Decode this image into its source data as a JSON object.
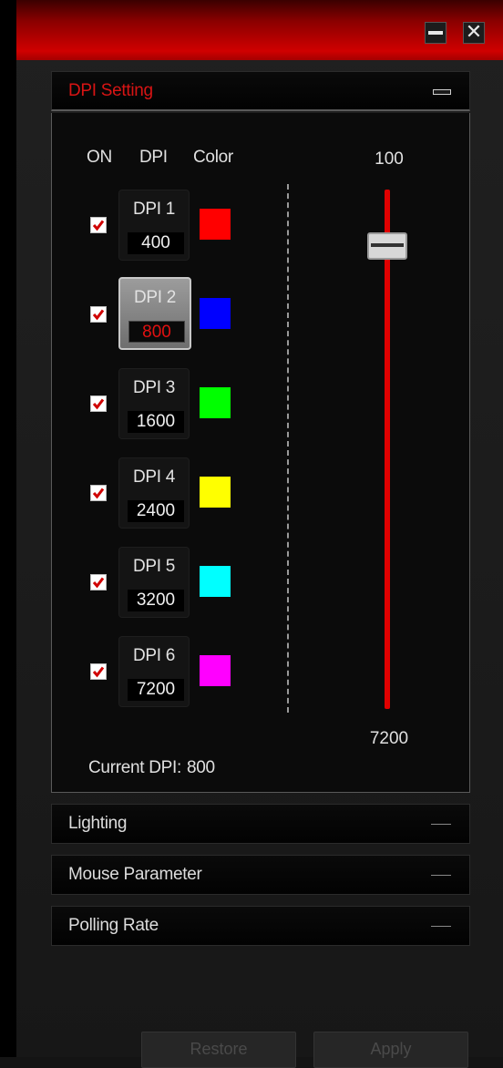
{
  "window": {
    "minimize_symbol": "",
    "close_symbol": "✕"
  },
  "dpi_panel": {
    "title": "DPI Setting",
    "columns": {
      "on": "ON",
      "dpi": "DPI",
      "color": "Color"
    },
    "levels": [
      {
        "label": "DPI 1",
        "value": "400",
        "enabled": true,
        "color": "#ff0000",
        "active": false
      },
      {
        "label": "DPI 2",
        "value": "800",
        "enabled": true,
        "color": "#0000ff",
        "active": true
      },
      {
        "label": "DPI 3",
        "value": "1600",
        "enabled": true,
        "color": "#00ff00",
        "active": false
      },
      {
        "label": "DPI 4",
        "value": "2400",
        "enabled": true,
        "color": "#ffff00",
        "active": false
      },
      {
        "label": "DPI 5",
        "value": "3200",
        "enabled": true,
        "color": "#00ffff",
        "active": false
      },
      {
        "label": "DPI 6",
        "value": "7200",
        "enabled": true,
        "color": "#ff00ff",
        "active": false
      }
    ],
    "slider": {
      "min_label": "100",
      "max_label": "7200",
      "value": 800,
      "min": 100,
      "max": 7200
    },
    "current_label": "Current DPI:",
    "current_value": "800"
  },
  "sections": {
    "lighting": "Lighting",
    "mouse_parameter": "Mouse Parameter",
    "polling_rate": "Polling Rate"
  },
  "footer": {
    "restore": "Restore",
    "apply": "Apply"
  },
  "colors": {
    "accent": "#e00000",
    "background": "#1b1b1b"
  }
}
